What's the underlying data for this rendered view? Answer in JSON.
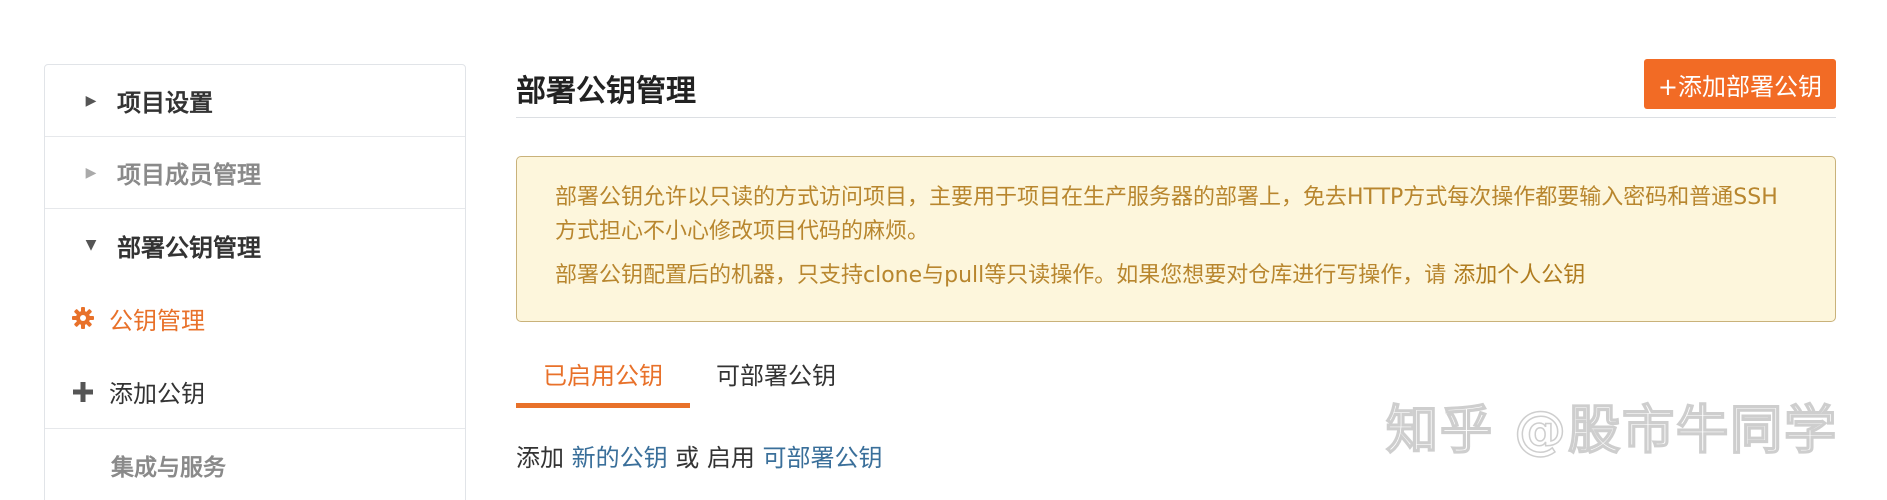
{
  "sidebar": {
    "project_settings": "项目设置",
    "member_management": "项目成员管理",
    "deploy_key_management": "部署公钥管理",
    "key_management": "公钥管理",
    "add_key": "添加公钥",
    "integration_services": "集成与服务"
  },
  "header": {
    "title": "部署公钥管理",
    "add_button": "+添加部署公钥"
  },
  "notice": {
    "line1": "部署公钥允许以只读的方式访问项目，主要用于项目在生产服务器的部署上，免去HTTP方式每次操作都要输入密码和普通SSH方式担心不小心修改项目代码的麻烦。",
    "line2_prefix": "部署公钥配置后的机器，只支持clone与pull等只读操作。如果您想要对仓库进行写操作，请 ",
    "line2_link": "添加个人公钥"
  },
  "tabs": {
    "enabled": "已启用公钥",
    "deployable": "可部署公钥"
  },
  "enable_line": {
    "prefix": "添加 ",
    "new_key_link": "新的公钥",
    "middle": " 或 启用 ",
    "deployable_link": "可部署公钥"
  },
  "watermark": "知乎 @股市牛同学",
  "colors": {
    "accent": "#f26b25",
    "notice_bg": "#fdf6dc",
    "notice_text": "#b8862e",
    "link": "#3a6f9a"
  }
}
